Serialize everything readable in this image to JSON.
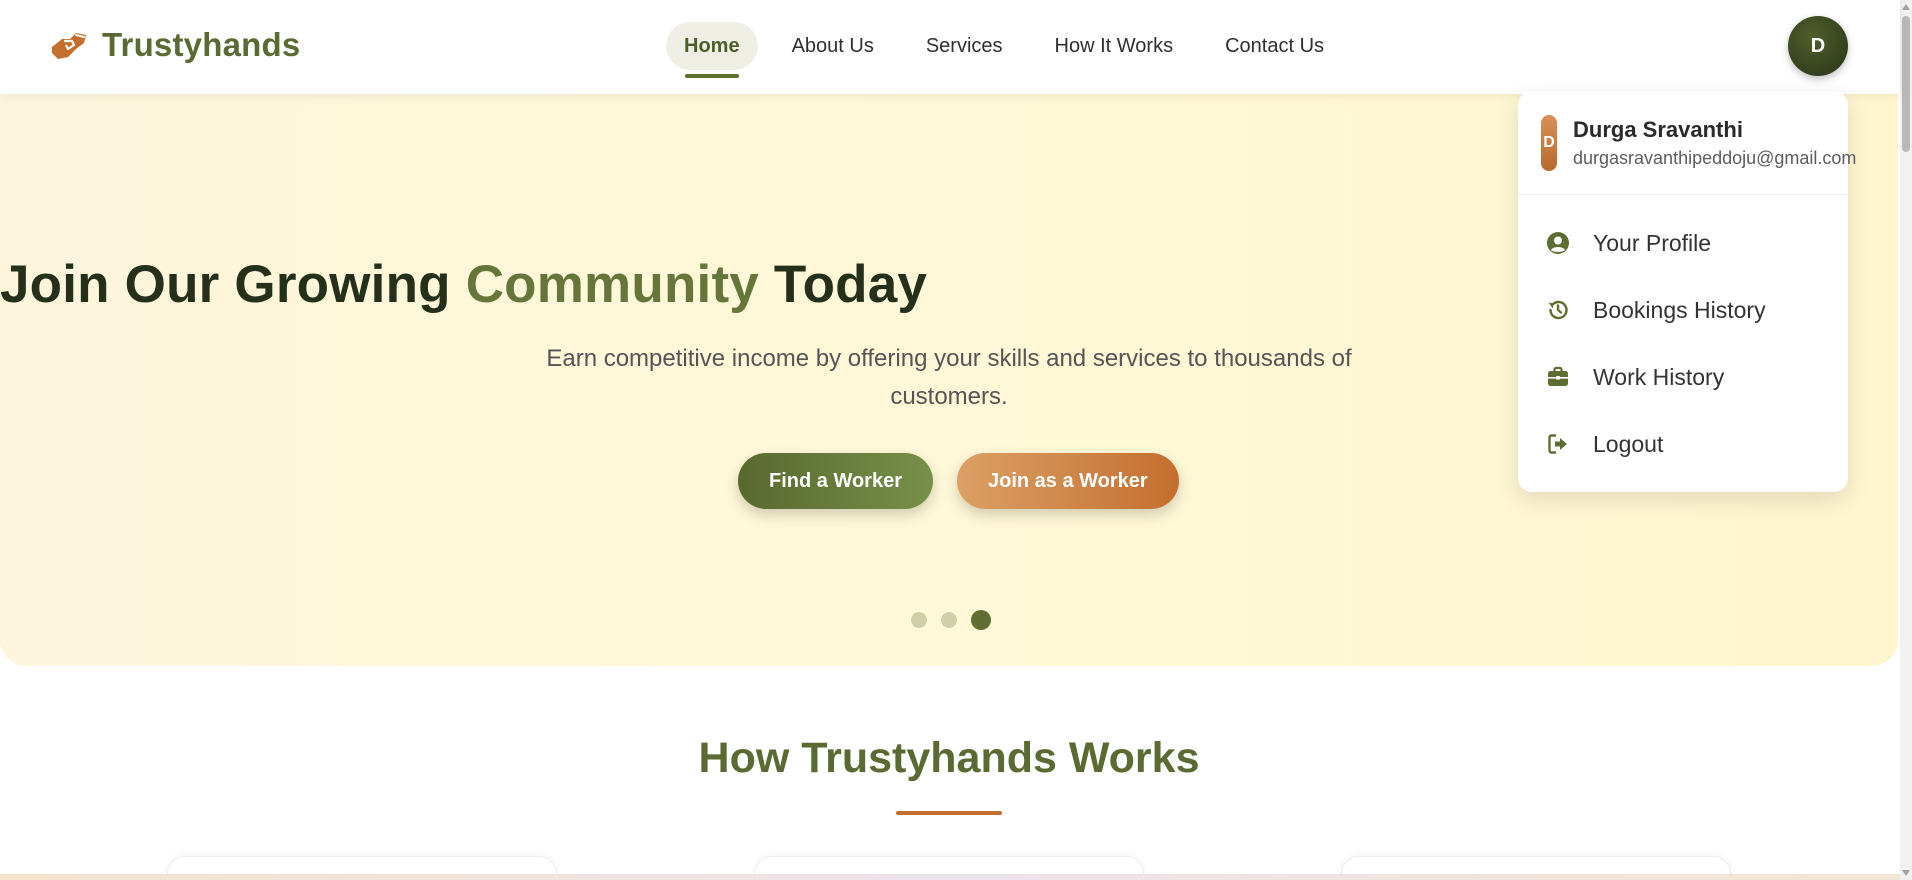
{
  "header": {
    "brand": "Trustyhands",
    "brand_color": "#5a6a32",
    "logo_icon": "handshake-icon",
    "nav": [
      {
        "label": "Home",
        "active": true
      },
      {
        "label": "About Us",
        "active": false
      },
      {
        "label": "Services",
        "active": false
      },
      {
        "label": "How It Works",
        "active": false
      },
      {
        "label": "Contact Us",
        "active": false
      }
    ],
    "avatar_initial": "D"
  },
  "hero": {
    "title_part1": "Join Our Growing ",
    "title_accent": "Community",
    "title_part2": " Today",
    "subtitle": "Earn competitive income by offering your skills and services to thousands of customers.",
    "primary_button": "Find a Worker",
    "secondary_button": "Join as a Worker",
    "slides_total": 3,
    "active_slide": 3
  },
  "how_it_works": {
    "title": "How Trustyhands Works"
  },
  "user_menu": {
    "avatar_initial": "D",
    "name": "Durga Sravanthi",
    "email": "durgasravanthipeddoju@gmail.com",
    "items": [
      {
        "label": "Your Profile",
        "icon": "user-circle-icon"
      },
      {
        "label": "Bookings History",
        "icon": "history-icon"
      },
      {
        "label": "Work History",
        "icon": "briefcase-icon"
      },
      {
        "label": "Logout",
        "icon": "logout-icon"
      }
    ]
  },
  "colors": {
    "olive": "#5d6e30",
    "orange": "#c46e2f",
    "hero_bg": "#fff8d8"
  }
}
